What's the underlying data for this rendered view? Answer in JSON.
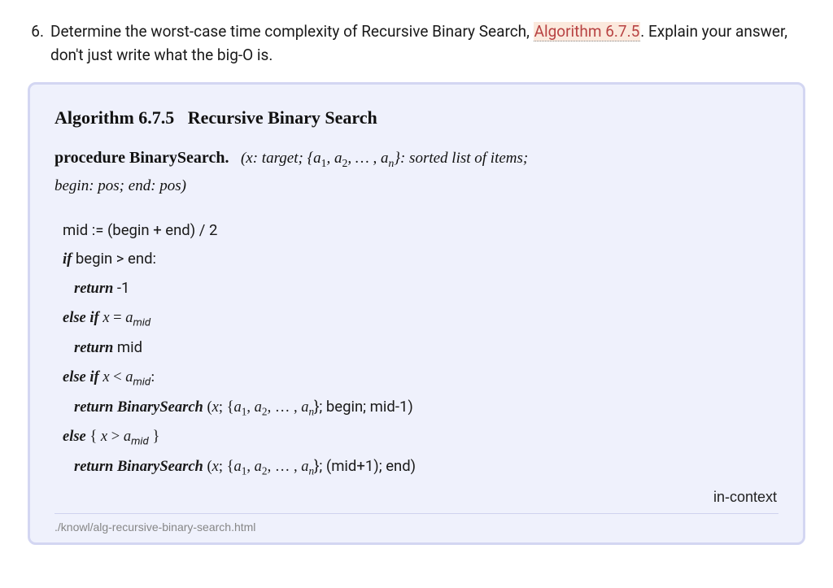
{
  "question": {
    "number": "6.",
    "text_before_link": "Determine the worst-case time complexity of Recursive Binary Search, ",
    "link_text": "Algorithm 6.7.5",
    "text_after_link1": ". Explain your answer, don't just write what the big-O is."
  },
  "algorithm": {
    "label": "Algorithm 6.7.5",
    "title": "Recursive Binary Search",
    "procedure_kw": "procedure",
    "procedure_name": "BinarySearch.",
    "signature_line1_prefix": "(",
    "signature_x": "x",
    "signature_x_desc": ": target;",
    "signature_list_open": " {",
    "signature_list_a1": "a",
    "signature_list_sub1": "1",
    "signature_list_comma1": ", ",
    "signature_list_a2": "a",
    "signature_list_sub2": "2",
    "signature_list_dots": ", … , ",
    "signature_list_an": "a",
    "signature_list_subn": "n",
    "signature_list_close": "}",
    "signature_list_desc": ": sorted list of items;",
    "signature_line2": "begin: pos; end: pos)",
    "code": {
      "l1": "mid := (begin + end) / 2",
      "l2_kw": "if",
      "l2_rest": " begin > end:",
      "l3_kw": "return",
      "l3_rest": " -1",
      "l4_kw": "else if ",
      "l4_math_x": "x",
      "l4_math_eq": " = ",
      "l4_math_a": "a",
      "l4_math_sub": "mid",
      "l5_kw": "return",
      "l5_rest": " mid",
      "l6_kw": "else if ",
      "l6_math_x": "x",
      "l6_math_lt": " < ",
      "l6_math_a": "a",
      "l6_math_sub": "mid",
      "l6_colon": ":",
      "l7_kw": "return ",
      "l7_fn": "BinarySearch",
      "l7_open": " (",
      "l7_x": "x",
      "l7_semi1": "; {",
      "l7_a1": "a",
      "l7_s1": "1",
      "l7_c1": ", ",
      "l7_a2": "a",
      "l7_s2": "2",
      "l7_dots": ", … , ",
      "l7_an": "a",
      "l7_sn": "n",
      "l7_close": "}; begin; mid-1)",
      "l8_kw": "else",
      "l8_brace_open": " { ",
      "l8_x": "x",
      "l8_gt": " > ",
      "l8_a": "a",
      "l8_sub": "mid",
      "l8_brace_close": " }",
      "l9_kw": "return ",
      "l9_fn": "BinarySearch",
      "l9_open": " (",
      "l9_x": "x",
      "l9_semi1": "; {",
      "l9_a1": "a",
      "l9_s1": "1",
      "l9_c1": ", ",
      "l9_a2": "a",
      "l9_s2": "2",
      "l9_dots": ", … , ",
      "l9_an": "a",
      "l9_sn": "n",
      "l9_close": "}; (mid+1); end)"
    },
    "incontext": "in-context",
    "footer_path": "./knowl/alg-recursive-binary-search.html"
  }
}
